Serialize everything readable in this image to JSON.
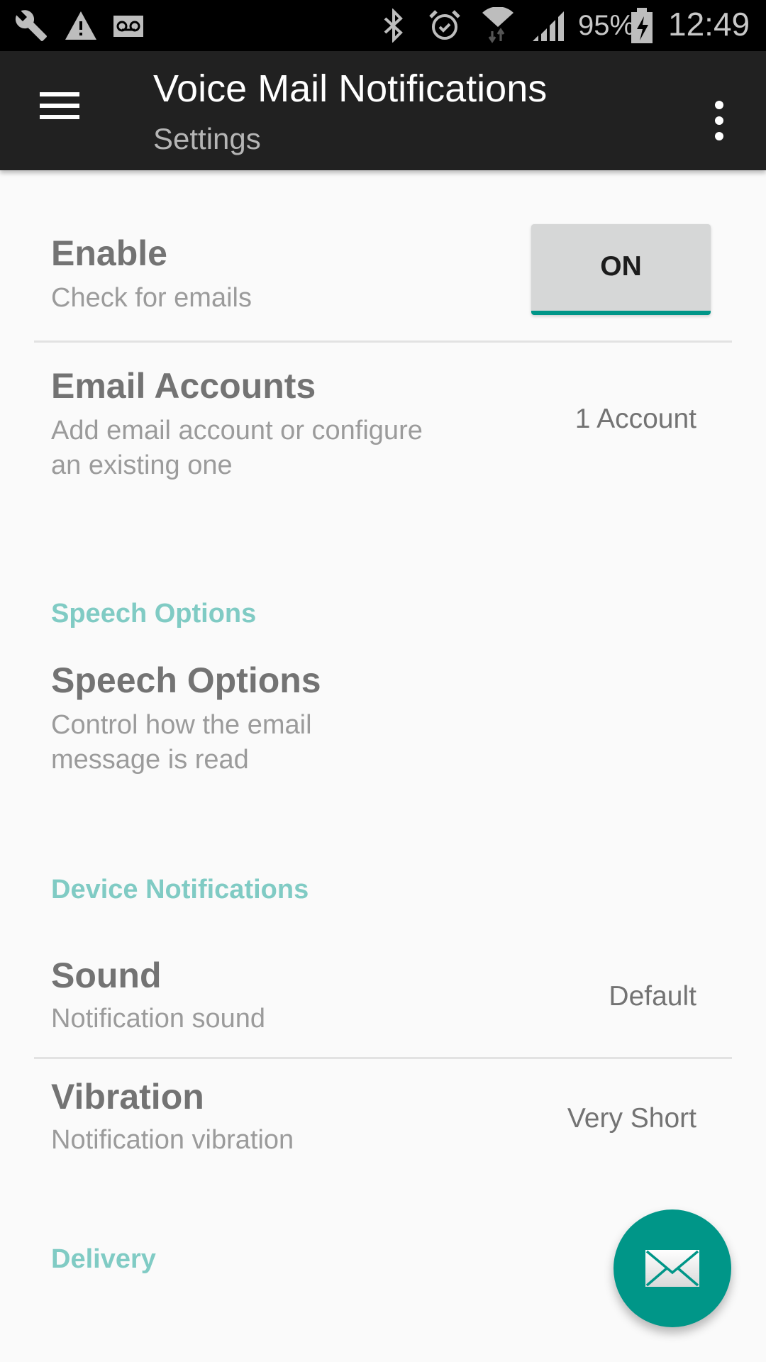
{
  "status_bar": {
    "left_icons": [
      "wrench-icon",
      "warning-icon",
      "voicemail-icon"
    ],
    "right_icons": [
      "bluetooth-icon",
      "alarm-icon",
      "wifi-icon",
      "cellular-signal-icon",
      "battery-charging-icon"
    ],
    "battery_percent": "95%",
    "time": "12:49"
  },
  "app_bar": {
    "title": "Voice Mail Notifications",
    "subtitle": "Settings",
    "menu_icon": "hamburger-menu-icon",
    "overflow_icon": "more-vert-icon"
  },
  "preferences": {
    "enable": {
      "title": "Enable",
      "summary": "Check for emails",
      "toggle_label": "ON",
      "toggle_state": true
    },
    "email_accounts": {
      "title": "Email Accounts",
      "summary_line1": "Add email account or configure",
      "summary_line2": "an existing one",
      "value": "1 Account"
    },
    "speech_category": "Speech Options",
    "speech_options": {
      "title": "Speech Options",
      "summary_line1": "Control how the email",
      "summary_line2": "message is read"
    },
    "device_category": "Device Notifications",
    "sound": {
      "title": "Sound",
      "summary": "Notification sound",
      "value": "Default"
    },
    "vibration": {
      "title": "Vibration",
      "summary": "Notification vibration",
      "value": "Very Short"
    },
    "delivery_category": "Delivery"
  },
  "fab": {
    "icon": "email-envelope-icon"
  },
  "colors": {
    "accent": "#009688",
    "category_text": "#80cbc4",
    "app_bar": "#212121",
    "background": "#fafafa"
  }
}
